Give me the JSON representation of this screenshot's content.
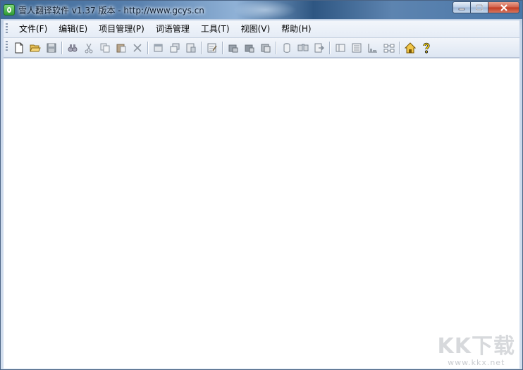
{
  "window": {
    "title": "雪人翻译软件 v1.37 版本 - http://www.gcys.cn"
  },
  "menubar": {
    "items": [
      "文件(F)",
      "编辑(E)",
      "项目管理(P)",
      "词语管理",
      "工具(T)",
      "视图(V)",
      "帮助(H)"
    ]
  },
  "toolbar": {
    "groups": [
      [
        "new-file-icon",
        "open-folder-icon",
        "save-icon"
      ],
      [
        "find-icon",
        "cut-icon",
        "copy-icon",
        "paste-icon",
        "delete-icon"
      ],
      [
        "window-icon",
        "windows-icon",
        "window-export-icon"
      ],
      [
        "edit-document-icon"
      ],
      [
        "database-icon",
        "database-add-icon",
        "database-remove-icon"
      ],
      [
        "cylinder-icon",
        "merge-icon",
        "export-icon"
      ],
      [
        "panel-icon",
        "list-icon",
        "chart-icon",
        "grid-icon"
      ],
      [
        "home-icon",
        "help-icon"
      ]
    ]
  },
  "watermark": {
    "logo": "KK下载",
    "url": "www.kkx.net"
  },
  "colors": {
    "titlebar": "#3f6a98",
    "close_button": "#c0391f",
    "menubar": "#eef3f9",
    "client": "#ffffff"
  }
}
